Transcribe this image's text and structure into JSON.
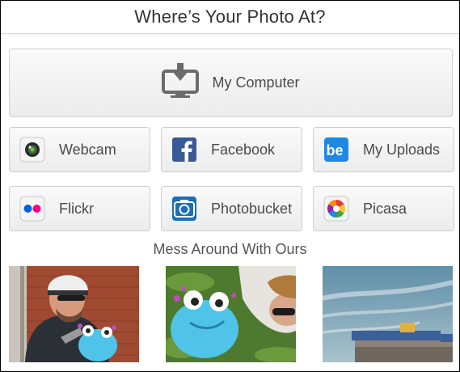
{
  "header": {
    "title": "Where’s Your Photo At?"
  },
  "sources": {
    "computer": {
      "label": "My Computer",
      "icon": "monitor-upload-icon"
    },
    "webcam": {
      "label": "Webcam",
      "icon": "webcam-icon"
    },
    "facebook": {
      "label": "Facebook",
      "icon": "facebook-icon"
    },
    "uploads": {
      "label": "My Uploads",
      "icon": "befunky-icon"
    },
    "flickr": {
      "label": "Flickr",
      "icon": "flickr-icon"
    },
    "photobucket": {
      "label": "Photobucket",
      "icon": "photobucket-icon"
    },
    "picasa": {
      "label": "Picasa",
      "icon": "picasa-icon"
    }
  },
  "samples": {
    "title": "Mess Around With Ours",
    "photos": [
      {
        "name": "sample-photo-biker"
      },
      {
        "name": "sample-photo-grass"
      },
      {
        "name": "sample-photo-sky"
      }
    ]
  },
  "colors": {
    "facebook": "#3b5998",
    "befunky": "#1e88e5",
    "flickr_pink": "#ff0084",
    "flickr_blue": "#0063dc"
  }
}
